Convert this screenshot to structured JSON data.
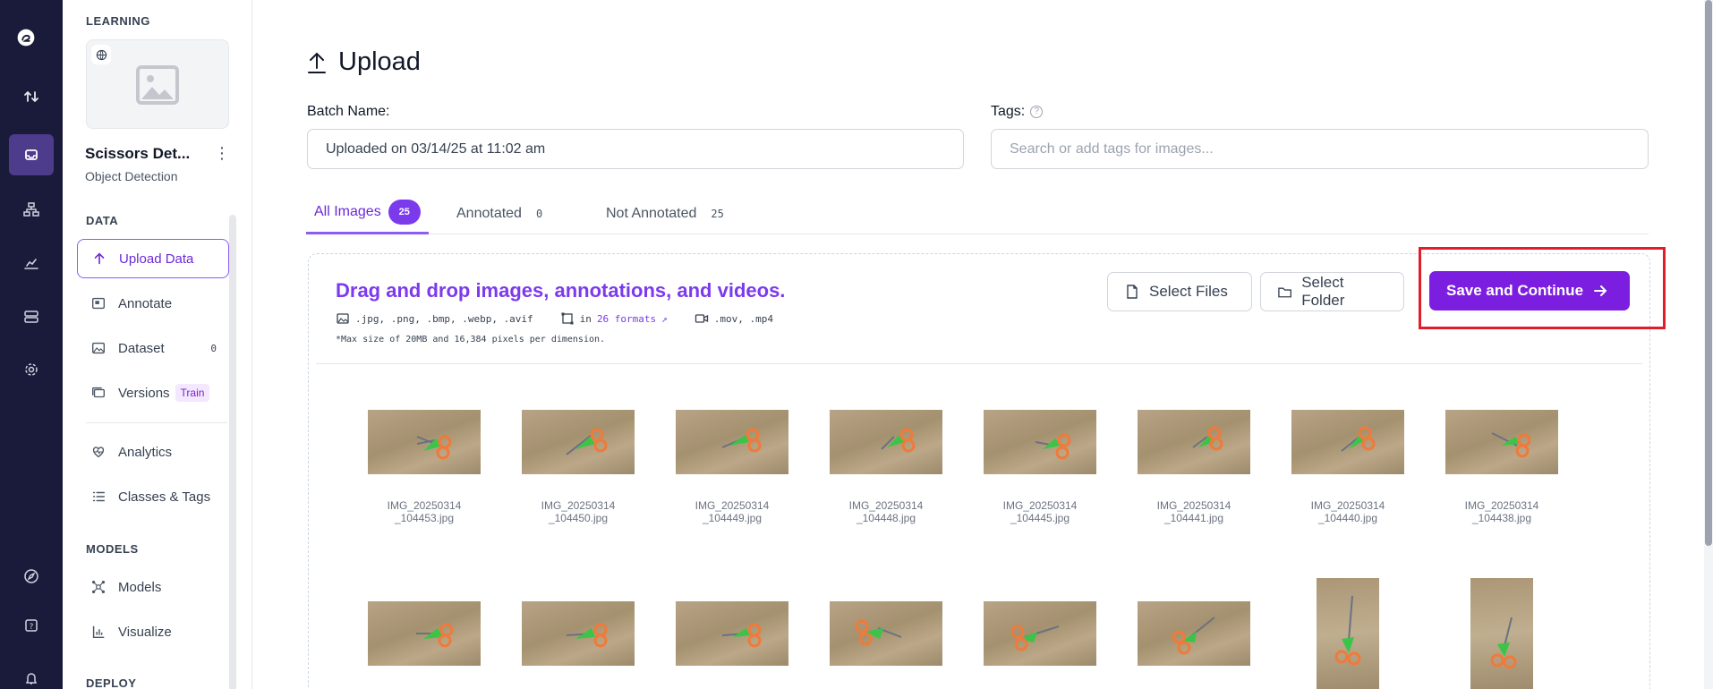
{
  "rail": {
    "icons": [
      "roboflow-logo-icon",
      "transfer-icon",
      "inbox-icon",
      "workflow-icon",
      "chart-icon",
      "storage-icon",
      "gear-icon",
      "compass-icon",
      "help-icon",
      "bell-icon"
    ]
  },
  "sidebar": {
    "learning_header": "LEARNING",
    "project_name": "Scissors Det...",
    "project_type": "Object Detection",
    "data_header": "DATA",
    "items": [
      {
        "label": "Upload Data",
        "icon": "upload-icon"
      },
      {
        "label": "Annotate",
        "icon": "annotate-icon"
      },
      {
        "label": "Dataset",
        "icon": "image-icon",
        "count": "0"
      },
      {
        "label": "Versions",
        "icon": "stack-icon",
        "badge": "Train"
      },
      {
        "label": "Analytics",
        "icon": "heart-pulse-icon"
      },
      {
        "label": "Classes & Tags",
        "icon": "list-icon"
      }
    ],
    "models_header": "MODELS",
    "model_items": [
      {
        "label": "Models",
        "icon": "nodes-icon"
      },
      {
        "label": "Visualize",
        "icon": "bar-chart-icon"
      }
    ],
    "deploy_header": "DEPLOY"
  },
  "main": {
    "title": "Upload",
    "batch_label": "Batch Name:",
    "batch_value": "Uploaded on 03/14/25 at 11:02 am",
    "tags_label": "Tags:",
    "tags_placeholder": "Search or add tags for images...",
    "tabs": [
      {
        "label": "All Images",
        "count": "25"
      },
      {
        "label": "Annotated",
        "count": "0"
      },
      {
        "label": "Not Annotated",
        "count": "25"
      }
    ],
    "drop_title": "Drag and drop images, annotations, and videos.",
    "image_formats": ".jpg, .png, .bmp, .webp, .avif",
    "annotation_prefix": "in",
    "annotation_link": "26 formats",
    "video_formats": ".mov, .mp4",
    "note": "*Max size of 20MB and 16,384 pixels per dimension.",
    "select_files": "Select Files",
    "select_folder": "Select Folder",
    "save_continue": "Save and Continue",
    "images": [
      {
        "name": "IMG_20250314\n_104453.jpg"
      },
      {
        "name": "IMG_20250314\n_104450.jpg"
      },
      {
        "name": "IMG_20250314\n_104449.jpg"
      },
      {
        "name": "IMG_20250314\n_104448.jpg"
      },
      {
        "name": "IMG_20250314\n_104445.jpg"
      },
      {
        "name": "IMG_20250314\n_104441.jpg"
      },
      {
        "name": "IMG_20250314\n_104440.jpg"
      },
      {
        "name": "IMG_20250314\n_104438.jpg"
      }
    ]
  },
  "colors": {
    "accent": "#7c1ee0",
    "rail_bg": "#1a1a3a",
    "highlight": "#e11d2a"
  }
}
